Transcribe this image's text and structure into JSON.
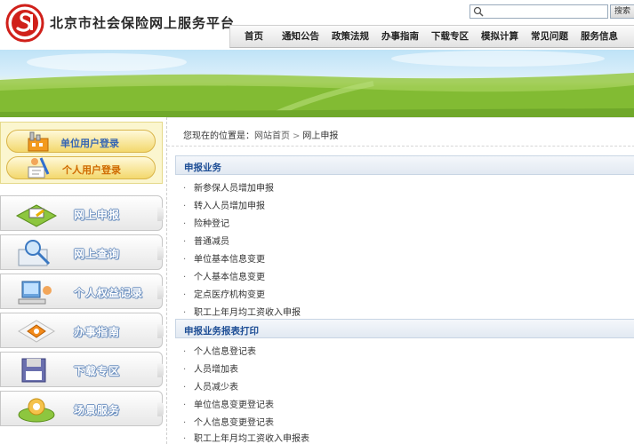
{
  "header": {
    "title": "北京市社会保险网上服务平台",
    "search": {
      "placeholder": "",
      "button_label": "搜索"
    }
  },
  "nav": {
    "items": [
      {
        "label": "首页"
      },
      {
        "label": "通知公告"
      },
      {
        "label": "政策法规"
      },
      {
        "label": "办事指南"
      },
      {
        "label": "下载专区"
      },
      {
        "label": "模拟计算"
      },
      {
        "label": "常见问题"
      },
      {
        "label": "服务信息"
      }
    ]
  },
  "login": {
    "unit_label": "单位用户登录",
    "personal_label": "个人用户登录"
  },
  "sidebar": {
    "items": [
      {
        "label": "网上申报",
        "icon": "online-declare-icon"
      },
      {
        "label": "网上查询",
        "icon": "online-query-icon"
      },
      {
        "label": "个人权益记录",
        "icon": "personal-record-icon"
      },
      {
        "label": "办事指南",
        "icon": "guide-icon"
      },
      {
        "label": "下载专区",
        "icon": "download-icon"
      },
      {
        "label": "场景服务",
        "icon": "scene-service-icon"
      }
    ]
  },
  "breadcrumb": {
    "prefix": "您现在的位置是：",
    "home": "网站首页",
    "sep": ">",
    "current": "网上申报"
  },
  "sections": [
    {
      "title": "申报业务",
      "items": [
        "新参保人员增加申报",
        "转入人员增加申报",
        "险种登记",
        "普通减员",
        "单位基本信息变更",
        "个人基本信息变更",
        "定点医疗机构变更",
        "职工上年月均工资收入申报"
      ]
    },
    {
      "title": "申报业务报表打印",
      "items": [
        "个人信息登记表",
        "人员增加表",
        "人员减少表",
        "单位信息变更登记表",
        "个人信息变更登记表",
        "职工上年月均工资收入申报表"
      ]
    }
  ],
  "colors": {
    "section_title": "#1f4f96",
    "menu_label_outline": "#6b8fbf",
    "logo_red": "#d0201a",
    "login_panel": "#fbf6cf"
  }
}
